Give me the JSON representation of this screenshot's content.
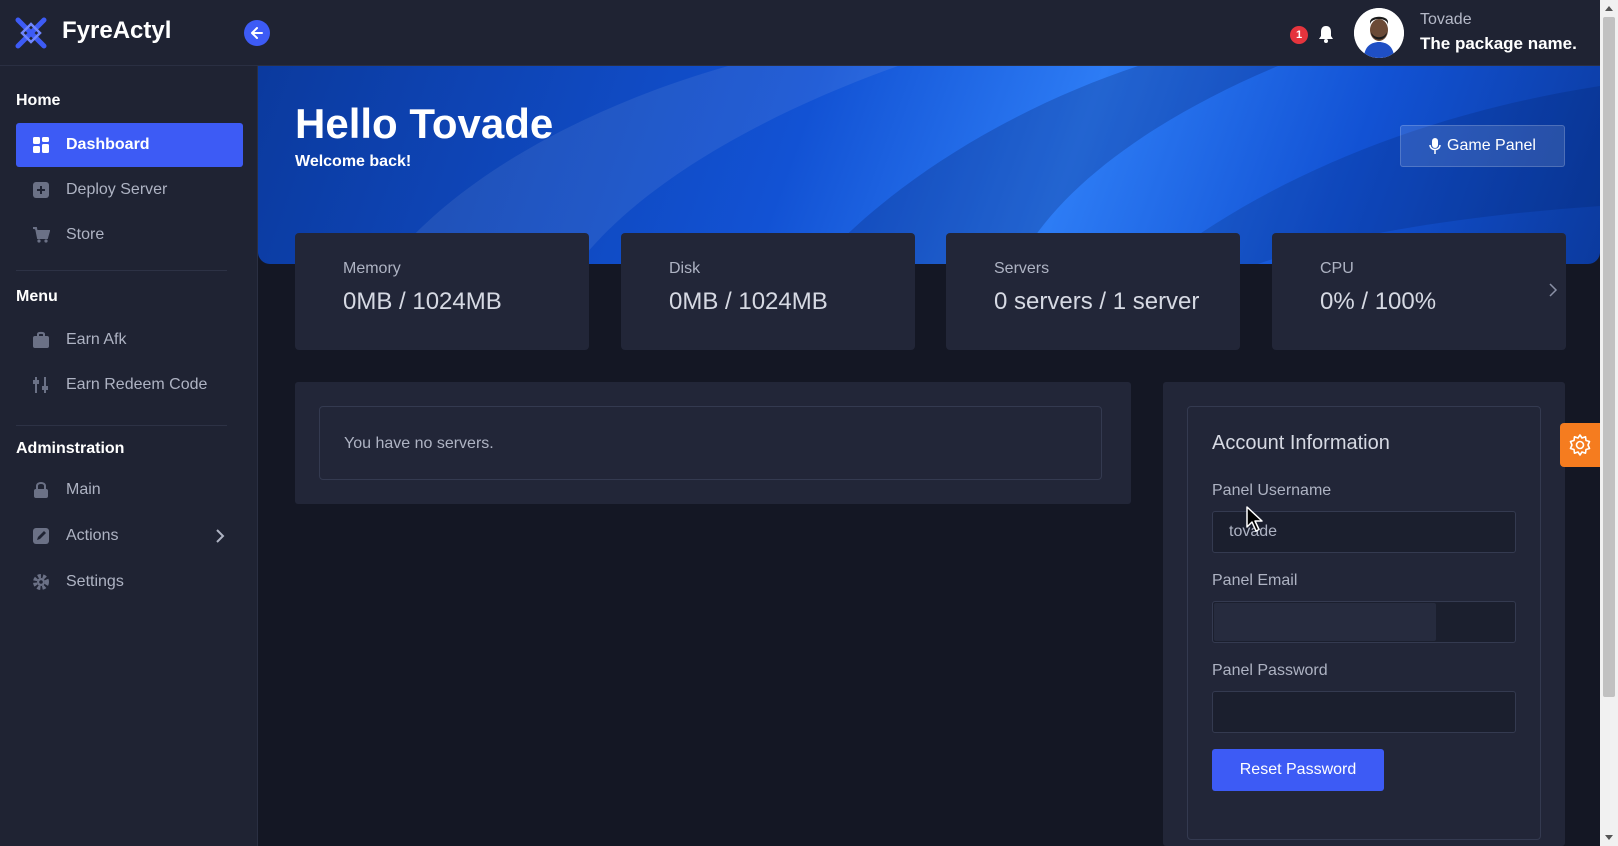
{
  "app": {
    "brand": "FyreActyl",
    "accent_color": "#3d5bf5",
    "notifications_count": "1",
    "user": {
      "name": "Tovade",
      "package": "The package name."
    }
  },
  "sidebar": {
    "sections": [
      {
        "title": "Home",
        "items": [
          {
            "label": "Dashboard",
            "icon": "dashboard-icon",
            "active": true
          },
          {
            "label": "Deploy Server",
            "icon": "plus-square-icon"
          },
          {
            "label": "Store",
            "icon": "cart-icon"
          }
        ]
      },
      {
        "title": "Menu",
        "items": [
          {
            "label": "Earn Afk",
            "icon": "bag-icon"
          },
          {
            "label": "Earn Redeem Code",
            "icon": "sliders-icon"
          }
        ]
      },
      {
        "title": "Adminstration",
        "items": [
          {
            "label": "Main",
            "icon": "lock-icon"
          },
          {
            "label": "Actions",
            "icon": "edit-icon"
          },
          {
            "label": "Settings",
            "icon": "gear-icon"
          }
        ]
      }
    ]
  },
  "hero": {
    "title": "Hello Tovade",
    "subtitle": "Welcome back!",
    "game_panel_label": "Game Panel"
  },
  "stats": [
    {
      "label": "Memory",
      "value": "0MB / 1024MB"
    },
    {
      "label": "Disk",
      "value": "0MB / 1024MB"
    },
    {
      "label": "Servers",
      "value": "0 servers / 1 server"
    },
    {
      "label": "CPU",
      "value": "0% / 100%"
    }
  ],
  "servers": {
    "empty_text": "You have no servers."
  },
  "account": {
    "title": "Account Information",
    "username_label": "Panel Username",
    "username_value": "tovade",
    "email_label": "Panel Email",
    "email_value": "",
    "password_label": "Panel Password",
    "password_value": "",
    "reset_label": "Reset Password"
  }
}
